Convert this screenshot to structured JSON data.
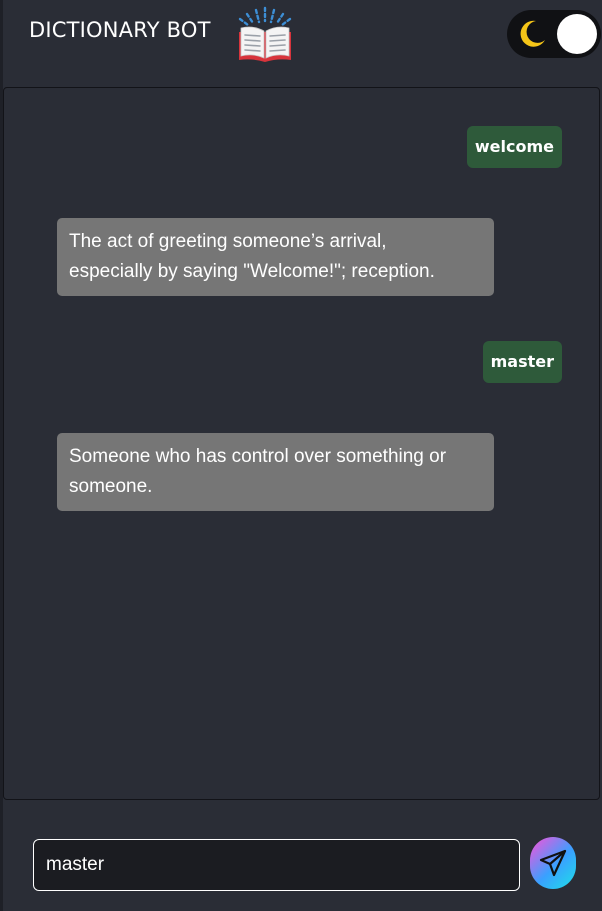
{
  "header": {
    "title": "DICTIONARY BOT",
    "book_icon": "open-book-icon",
    "theme_toggle": {
      "icon": "moon-icon",
      "mode": "dark"
    }
  },
  "chat": {
    "messages": [
      {
        "role": "user",
        "text": "welcome"
      },
      {
        "role": "bot",
        "lines": [
          "The act of greeting someone’s arrival,",
          "especially by saying \"Welcome!\"; reception."
        ]
      },
      {
        "role": "user",
        "text": "master"
      },
      {
        "role": "bot",
        "lines": [
          "Someone who has control over something or",
          "someone."
        ]
      }
    ]
  },
  "input": {
    "value": "master",
    "send_icon": "paper-plane-icon"
  },
  "colors": {
    "background": "#2a2d36",
    "user_bubble": "#2e5a3a",
    "bot_bubble": "#767676",
    "moon": "#f5c518"
  }
}
